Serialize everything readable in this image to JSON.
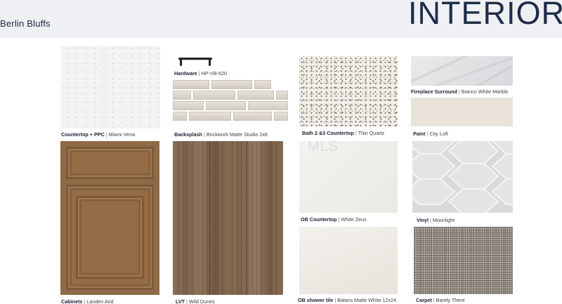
{
  "header": {
    "subtitle": "Berlin Bluffs",
    "title": "INTERIOR"
  },
  "watermark": "MLS",
  "swatches": [
    {
      "id": "countertop-ppc",
      "label": "Countertop + PPC",
      "value": "Miami Vena",
      "color": "#f4f5f3"
    },
    {
      "id": "hardware",
      "label": "Hardware",
      "value": "HP-VB-620",
      "color": "#2a2a2a"
    },
    {
      "id": "backsplash",
      "label": "Backsplash",
      "value": "Brickwork Matte Studio 2x8",
      "color": "#dcd6cc"
    },
    {
      "id": "bath-countertop",
      "label": "Bath 2 &3 Countertop",
      "value": "Thin Quartz",
      "color": "#f1eee9"
    },
    {
      "id": "fireplace",
      "label": "Fireplace Surround",
      "value": "Bianco White Marble",
      "color": "#e0e1e3"
    },
    {
      "id": "paint",
      "label": "Paint",
      "value": "City Loft",
      "color": "#e9e3db"
    },
    {
      "id": "cabinets",
      "label": "Cabinets",
      "value": "Landen Arid",
      "color": "#8f6a46"
    },
    {
      "id": "lvt",
      "label": "LVT",
      "value": "Wild Dunes",
      "color": "#7f664e"
    },
    {
      "id": "ob-countertop",
      "label": "OB Countertop",
      "value": "White Zeus",
      "color": "#f0f0ec"
    },
    {
      "id": "vinyl",
      "label": "Vinyl",
      "value": "Moonlight",
      "color": "#d8d9da"
    },
    {
      "id": "ob-shower-tile",
      "label": "OB shower tile",
      "value": "Balans Matte White 12x24",
      "color": "#eeebe5"
    },
    {
      "id": "carpet",
      "label": "Carpet",
      "value": "Barely There",
      "color": "#a49c92"
    }
  ]
}
